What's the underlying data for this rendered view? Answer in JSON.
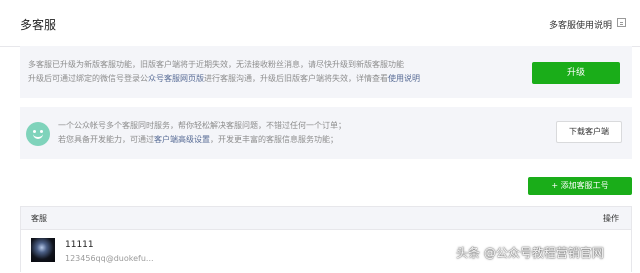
{
  "header": {
    "title": "多客服",
    "help_link": "多客服使用说明",
    "help_icon": "external-doc-icon"
  },
  "upgrade_notice": {
    "line1": "多客服已升级为新版客服功能，旧版客户端将于近期失效，无法接收粉丝消息，请尽快升级到新版客服功能",
    "line2_prefix": "升级后可通过绑定的微信号登录公",
    "line2_link1": "众号客服网页版",
    "line2_middle": "进行客服沟通，升级后旧版客户端将失效，详情查看",
    "line2_link2": "使用说明",
    "button": "升级"
  },
  "promo": {
    "icon": "smile-icon",
    "line1": "一个公众帐号多个客服同时服务，帮你轻松解决客服问题，不错过任何一个订单；",
    "line2_prefix": "若您具备开发能力，可通过",
    "line2_link": "客户端高级设置",
    "line2_suffix": "，开发更丰富的客服信息服务功能；",
    "button": "下载客户端"
  },
  "add_button": "+ 添加客服工号",
  "table": {
    "headers": {
      "agent": "客服",
      "actions": "操作"
    },
    "rows": [
      {
        "name": "11111",
        "account": "123456qq@duokefu..."
      }
    ]
  },
  "watermark": "头条 @公众号教程营销官网",
  "colors": {
    "accent_green": "#1aad19",
    "link_blue": "#576b95",
    "panel_bg": "#f4f5f9",
    "smile_teal": "#7fd3bb"
  }
}
